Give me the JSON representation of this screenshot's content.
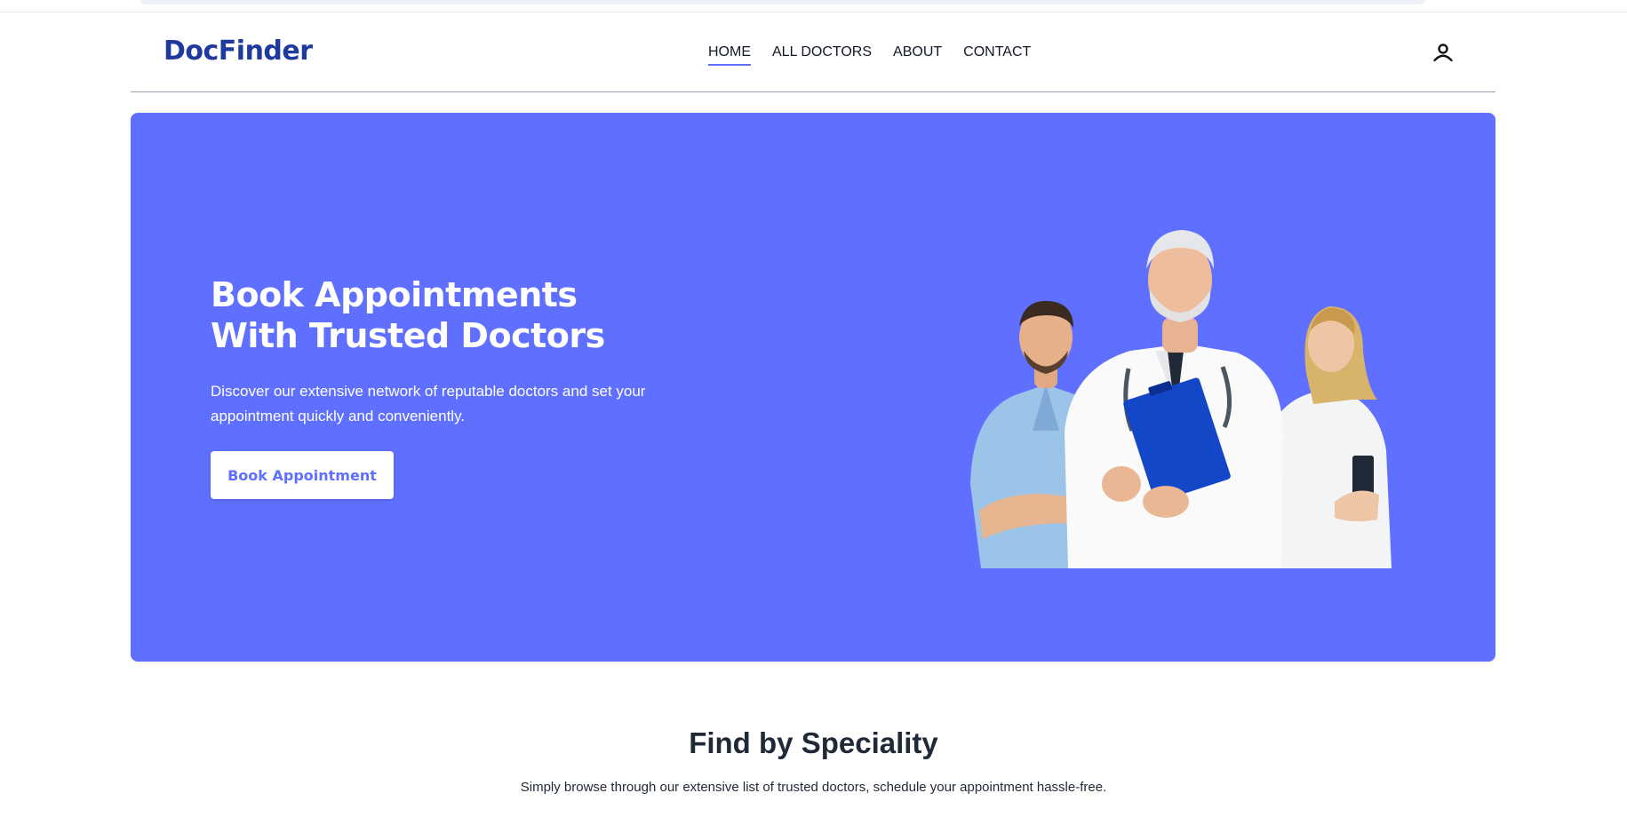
{
  "brand": {
    "name": "DocFinder",
    "color": "#1e3a9e",
    "accent": "#5f6fff"
  },
  "nav": {
    "items": [
      {
        "label": "HOME",
        "active": true
      },
      {
        "label": "ALL DOCTORS",
        "active": false
      },
      {
        "label": "ABOUT",
        "active": false
      },
      {
        "label": "CONTACT",
        "active": false
      }
    ],
    "account_icon": "user-icon"
  },
  "hero": {
    "title_line1": "Book Appointments",
    "title_line2": "With Trusted Doctors",
    "description": "Discover our extensive network of reputable doctors and set your appointment quickly and conveniently.",
    "button_label": "Book Appointment",
    "image_subject": "group of three doctors"
  },
  "speciality": {
    "title": "Find by Speciality",
    "subtitle": "Simply browse through our extensive list of trusted doctors, schedule your appointment hassle-free."
  }
}
